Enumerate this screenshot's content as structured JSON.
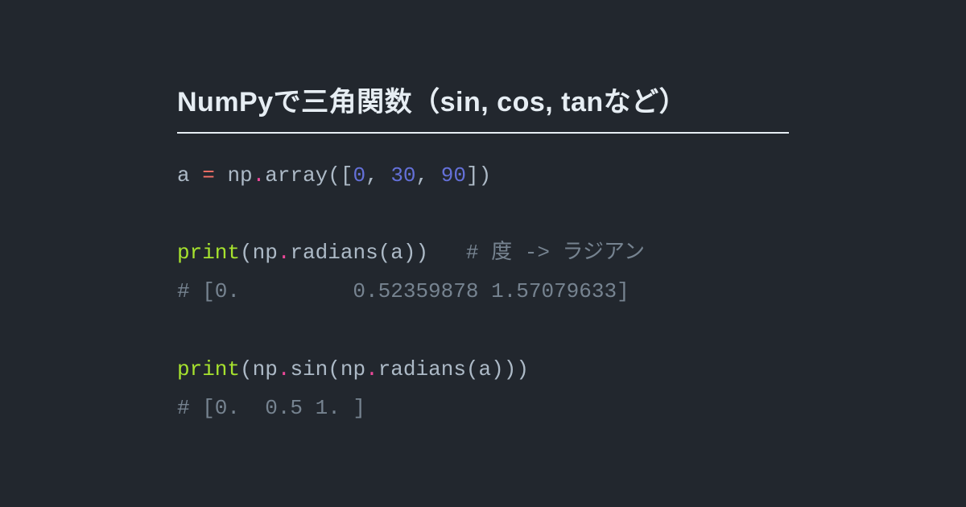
{
  "title": "NumPyで三角関数（sin, cos, tanなど）",
  "code": {
    "l1": {
      "a": "a",
      "sp1": " ",
      "eq": "=",
      "sp2": " ",
      "np": "np",
      "dot": ".",
      "array": "array",
      "op": "(",
      "ob": "[",
      "n0": "0",
      "c1": ",",
      "sp3": " ",
      "n1": "30",
      "c2": ",",
      "sp4": " ",
      "n2": "90",
      "cb": "]",
      "cp": ")"
    },
    "l3": {
      "print": "print",
      "op1": "(",
      "np": "np",
      "dot": ".",
      "rad": "radians",
      "op2": "(",
      "a": "a",
      "cp2": ")",
      "cp1": ")",
      "pad": "   ",
      "cm": "# 度 -> ラジアン"
    },
    "l4": {
      "cm": "# [0.         0.52359878 1.57079633]"
    },
    "l6": {
      "print": "print",
      "op1": "(",
      "np1": "np",
      "dot1": ".",
      "sin": "sin",
      "op2": "(",
      "np2": "np",
      "dot2": ".",
      "rad": "radians",
      "op3": "(",
      "a": "a",
      "cp3": ")",
      "cp2": ")",
      "cp1": ")"
    },
    "l7": {
      "cm": "# [0.  0.5 1. ]"
    }
  }
}
